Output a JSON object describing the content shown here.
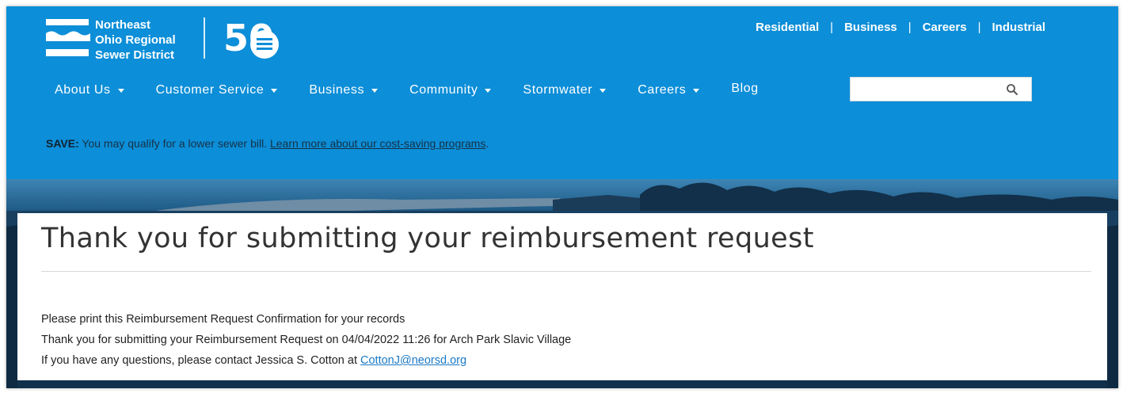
{
  "logo": {
    "line1": "Northeast",
    "line2": "Ohio Regional",
    "line3": "Sewer District",
    "anniversary": "50"
  },
  "utility_nav": {
    "items": [
      "Residential",
      "Business",
      "Careers",
      "Industrial"
    ],
    "separator": "|"
  },
  "main_nav": {
    "items": [
      {
        "label": "About Us",
        "has_dropdown": true
      },
      {
        "label": "Customer Service",
        "has_dropdown": true
      },
      {
        "label": "Business",
        "has_dropdown": true
      },
      {
        "label": "Community",
        "has_dropdown": true
      },
      {
        "label": "Stormwater",
        "has_dropdown": true
      },
      {
        "label": "Careers",
        "has_dropdown": true
      },
      {
        "label": "Blog",
        "has_dropdown": false
      }
    ],
    "search": {
      "value": "",
      "placeholder": "",
      "icon": "search-icon"
    }
  },
  "notice": {
    "label": "SAVE:",
    "text": "You may qualify for a lower sewer bill.",
    "link_text": "Learn more about our cost-saving programs",
    "trailing": "."
  },
  "confirmation": {
    "title": "Thank you for submitting your reimbursement request",
    "line1": "Please print this Reimbursement Request Confirmation for your records",
    "line2": "Thank you for submitting your Reimbursement Request on 04/04/2022 11:26 for Arch Park Slavic Village",
    "line3_prefix": "If you have any questions, please contact Jessica S. Cotton at",
    "line3_email": "CottonJ@neorsd.org"
  },
  "colors": {
    "header_blue": "#0c8ed8",
    "link_blue": "#1a79c6",
    "title_gray": "#333333"
  }
}
